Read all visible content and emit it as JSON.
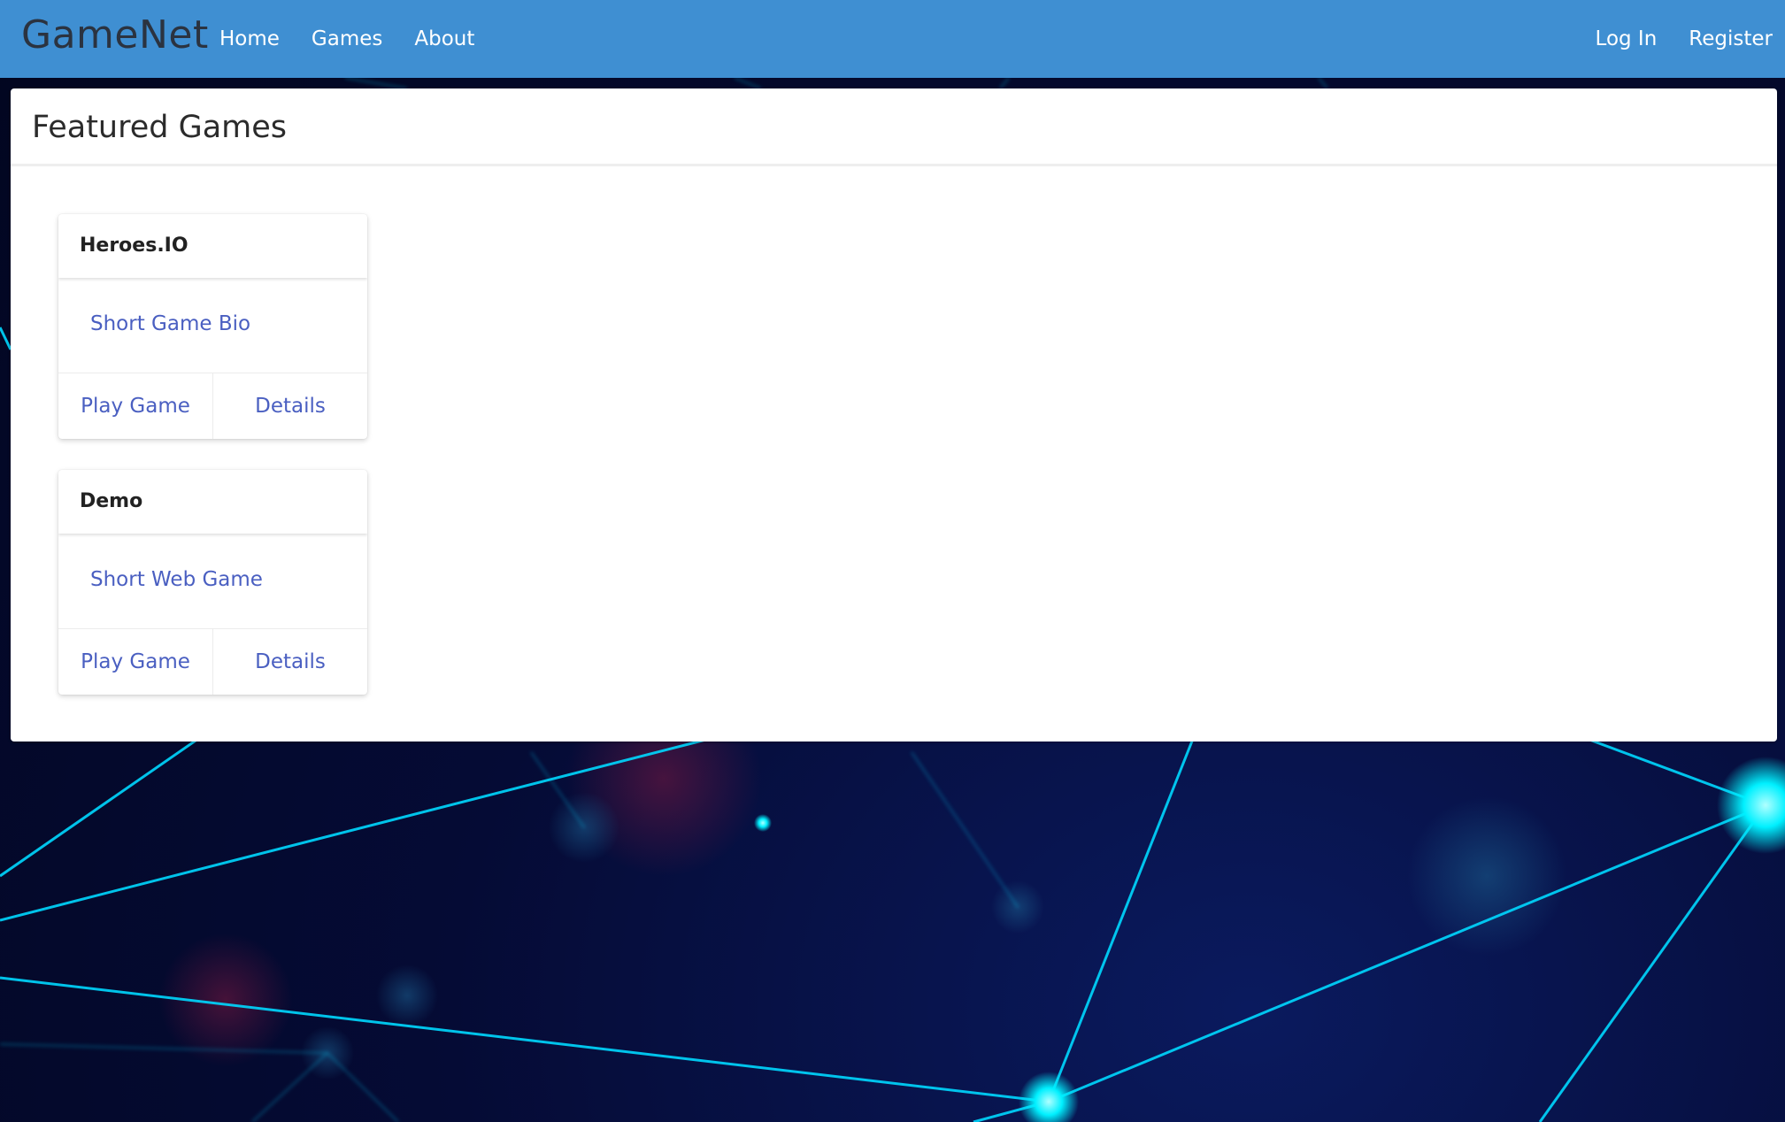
{
  "navbar": {
    "brand": "GameNet",
    "links_left": [
      "Home",
      "Games",
      "About"
    ],
    "links_right": [
      "Log In",
      "Register"
    ],
    "background": "#3f8fd2"
  },
  "panel": {
    "title": "Featured Games"
  },
  "games": [
    {
      "title": "Heroes.IO",
      "bio": "Short Game Bio",
      "play_label": "Play Game",
      "details_label": "Details"
    },
    {
      "title": "Demo",
      "bio": "Short Web Game",
      "play_label": "Play Game",
      "details_label": "Details"
    }
  ],
  "colors": {
    "link": "#4a5fc1",
    "background_dark": "#050b35",
    "network_glow": "#00e5ff"
  }
}
